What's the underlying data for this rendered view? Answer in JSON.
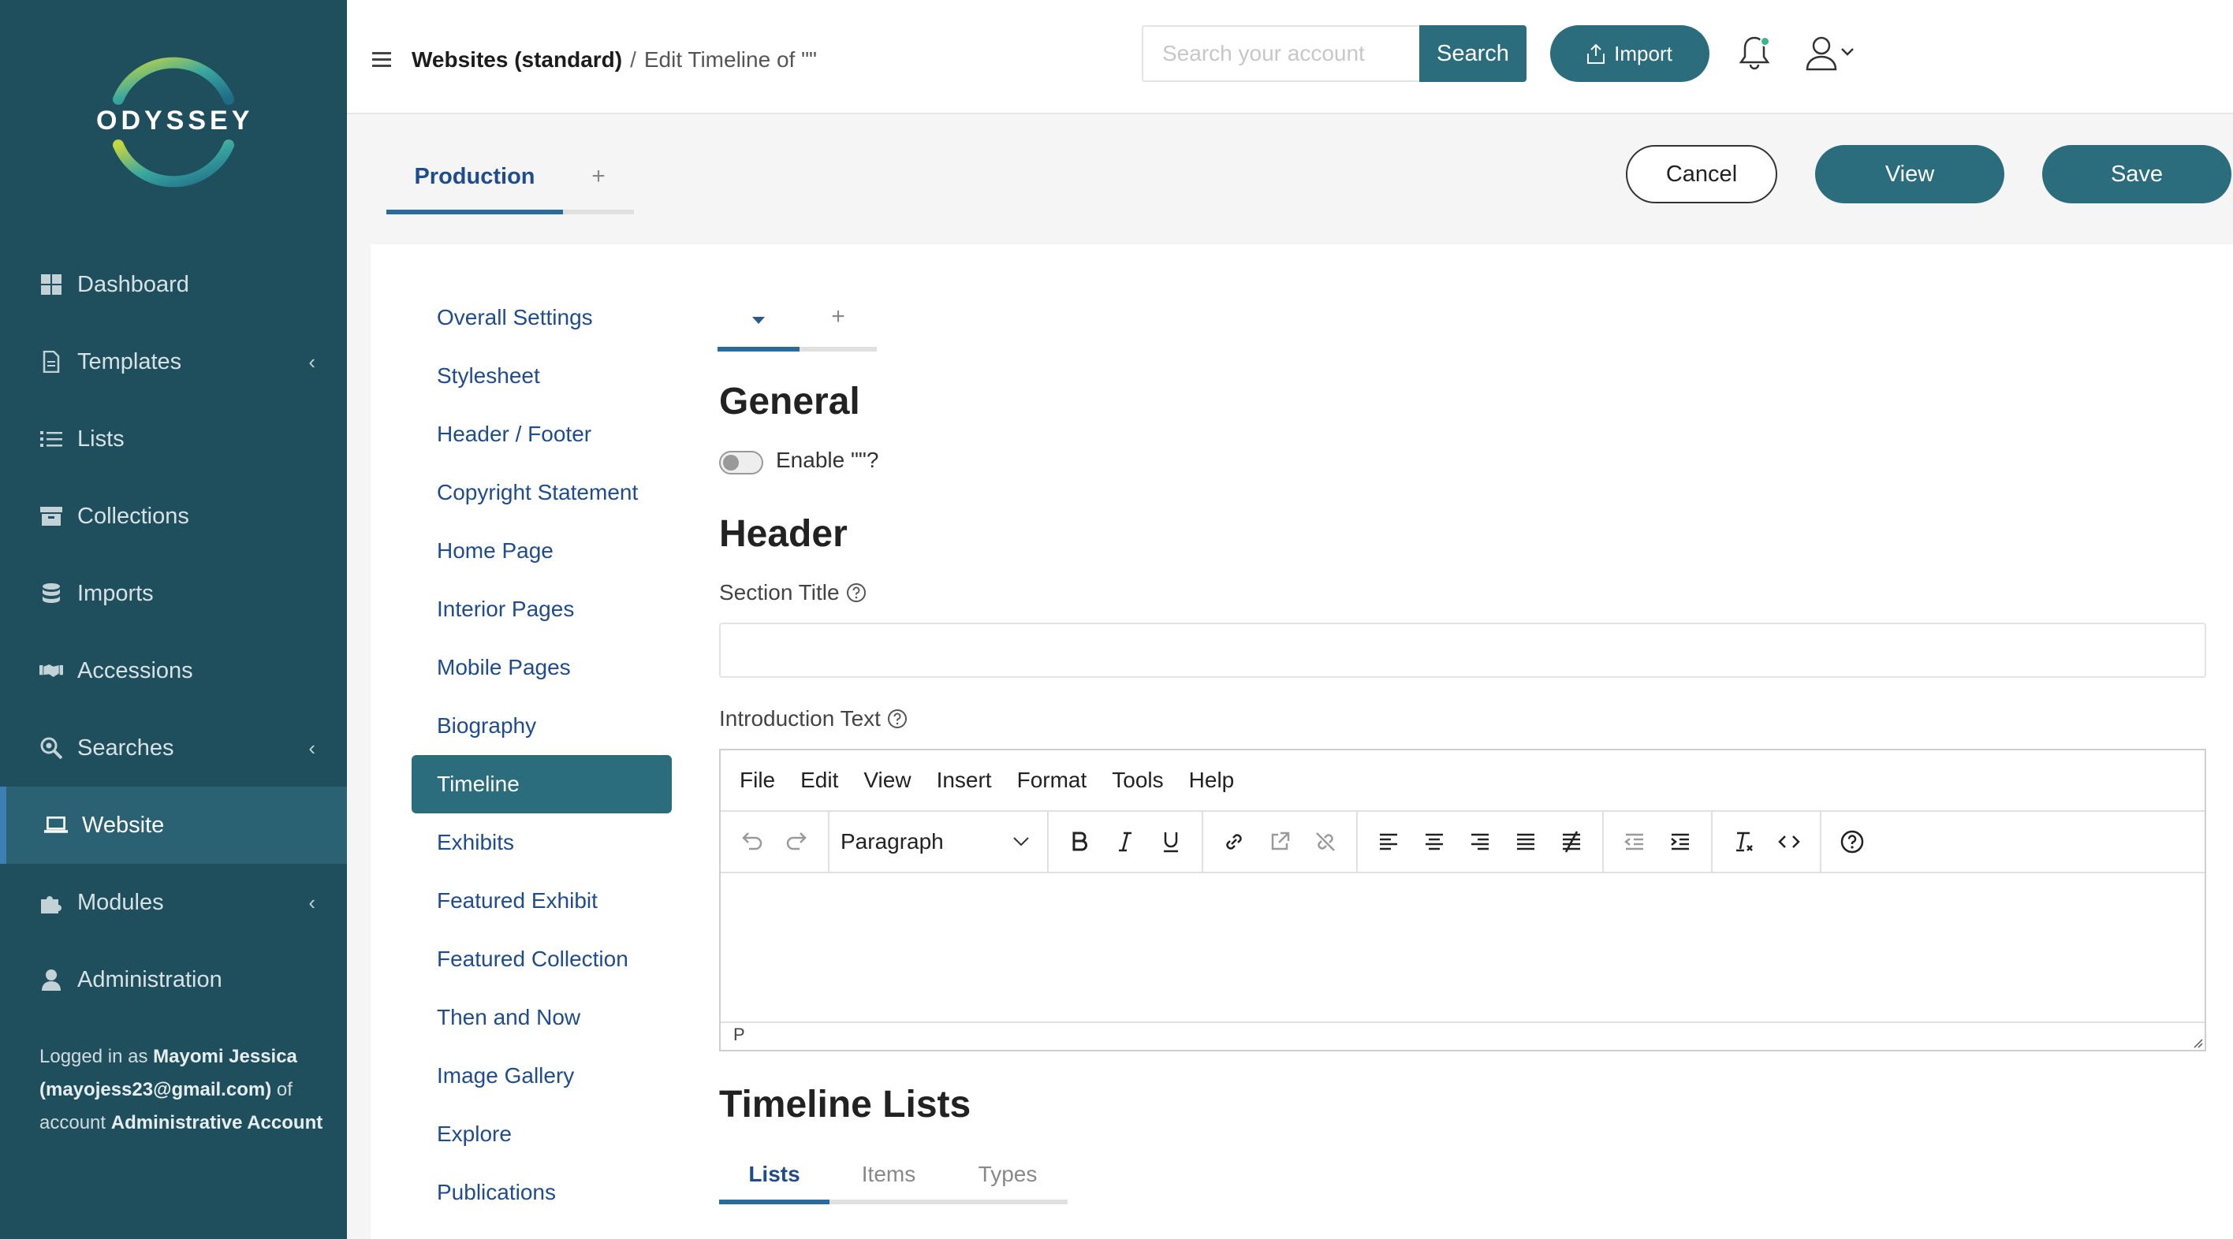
{
  "brand": {
    "name": "ODYSSEY",
    "ring_colors": [
      "#c6d640",
      "#3aa7a0",
      "#1f6c86"
    ]
  },
  "sidebar": {
    "items": [
      {
        "label": "Dashboard",
        "icon": "dashboard-icon",
        "has_chevron": false
      },
      {
        "label": "Templates",
        "icon": "document-icon",
        "has_chevron": true
      },
      {
        "label": "Lists",
        "icon": "list-icon",
        "has_chevron": false
      },
      {
        "label": "Collections",
        "icon": "archive-box-icon",
        "has_chevron": false
      },
      {
        "label": "Imports",
        "icon": "database-icon",
        "has_chevron": false
      },
      {
        "label": "Accessions",
        "icon": "handshake-icon",
        "has_chevron": false
      },
      {
        "label": "Searches",
        "icon": "search-gear-icon",
        "has_chevron": true
      },
      {
        "label": "Website",
        "icon": "laptop-icon",
        "has_chevron": false,
        "active": true
      },
      {
        "label": "Modules",
        "icon": "puzzle-icon",
        "has_chevron": true
      },
      {
        "label": "Administration",
        "icon": "user-icon",
        "has_chevron": false
      }
    ],
    "logged_in": {
      "prefix": "Logged in as ",
      "user": "Mayomi Jessica (mayojess23@gmail.com)",
      "middle": " of account ",
      "account": "Administrative Account"
    }
  },
  "header": {
    "breadcrumb_root": "Websites (standard)",
    "breadcrumb_separator": "/",
    "breadcrumb_current": "Edit Timeline of \"\"",
    "search_placeholder": "Search your account",
    "search_label": "Search",
    "import_label": "Import",
    "notification_dot_color": "#3bb58a"
  },
  "toolbar": {
    "tabs": [
      {
        "label": "Production"
      },
      {
        "label": "+"
      }
    ],
    "cancel_label": "Cancel",
    "view_label": "View",
    "save_label": "Save"
  },
  "subnav": {
    "items": [
      "Overall Settings",
      "Stylesheet",
      "Header / Footer",
      "Copyright Statement",
      "Home Page",
      "Interior Pages",
      "Mobile Pages",
      "Biography",
      "Timeline",
      "Exhibits",
      "Featured Exhibit",
      "Featured Collection",
      "Then and Now",
      "Image Gallery",
      "Explore",
      "Publications"
    ],
    "active": "Timeline"
  },
  "inner_tabs": {
    "add_label": "+"
  },
  "form": {
    "general_heading": "General",
    "enable_label": "Enable \"\"?",
    "enable_on": false,
    "header_heading": "Header",
    "section_title_label": "Section Title",
    "section_title_value": "",
    "intro_label": "Introduction Text",
    "editor": {
      "menu": [
        "File",
        "Edit",
        "View",
        "Insert",
        "Format",
        "Tools",
        "Help"
      ],
      "format_value": "Paragraph",
      "status_path": "P"
    },
    "timeline_heading": "Timeline Lists",
    "timeline_tabs": [
      "Lists",
      "Items",
      "Types"
    ]
  }
}
